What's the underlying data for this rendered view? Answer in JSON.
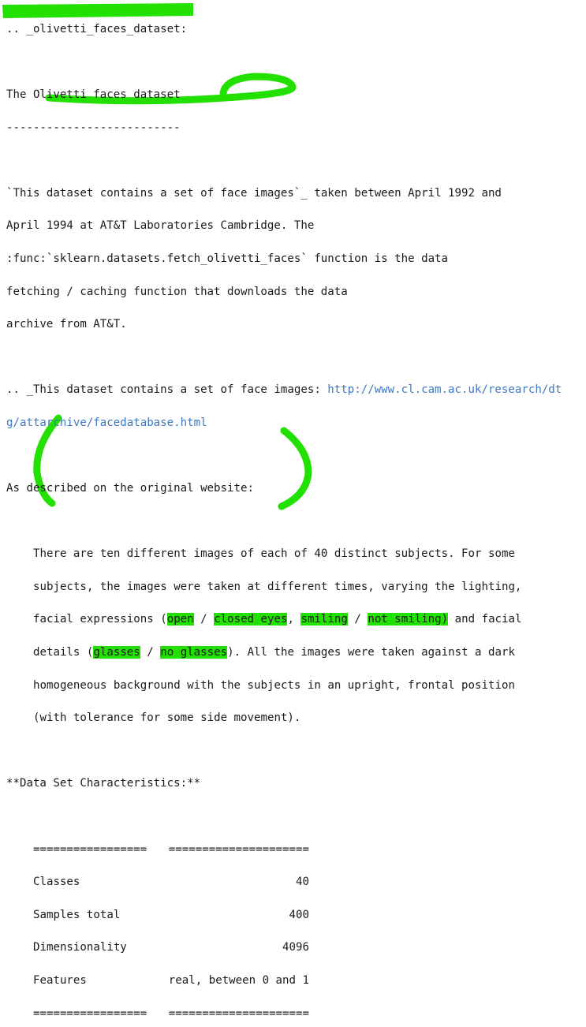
{
  "label": ".. _olivetti_faces_dataset:",
  "title": "The Olivetti faces dataset",
  "title_underline": "--------------------------",
  "intro": {
    "l1_a": "`This ",
    "l1_b": "dataset contains a set of face images",
    "l1_c": "`_ taken between April 1992 and",
    "l2": "April 1994 at AT&T Laboratories Cambridge. The",
    "l3": ":func:`sklearn.datasets.fetch_olivetti_faces` function is the data",
    "l4": "fetching / caching function that downloads the data",
    "l5": "archive from AT&T."
  },
  "ref": {
    "prefix": ".. _This dataset contains a set of face images: ",
    "url_part1": "http://www.cl.cam.ac.uk/research/dt",
    "url_part2": "g/attarchive/facedatabase.html"
  },
  "described": "As described on the original website:",
  "quote": {
    "l1": "There are ten different images of each of 40 distinct subjects. For some",
    "l2": "subjects, the images were taken at different times, varying the lighting,",
    "l3_a": "facial expressions (",
    "open": "open",
    "sep1": " / ",
    "closed": "closed eyes",
    "comma": ", ",
    "smiling": "smiling",
    "sep2": " / ",
    "not_smiling": "not smiling)",
    "l3_b": " and facial",
    "l4_a": "details (",
    "glasses": "glasses",
    "sep3": " / ",
    "no_glasses": "no glasses",
    "l4_b": "). All the images were taken against a dark",
    "l5": "homogeneous background with the subjects in an upright, frontal position",
    "l6": "(with tolerance for some side movement)."
  },
  "characteristics_heading": "**Data Set Characteristics:**",
  "table": {
    "rule_left": "=================",
    "rule_right": "=====================",
    "rows": [
      {
        "label": "Classes",
        "value": "40"
      },
      {
        "label": "Samples total",
        "value": "400"
      },
      {
        "label": "Dimensionality",
        "value": "4096"
      },
      {
        "label": "Features",
        "value": "real, between 0 and 1"
      }
    ]
  },
  "colors": {
    "highlight": "#22e000",
    "link": "#3f78c0"
  }
}
